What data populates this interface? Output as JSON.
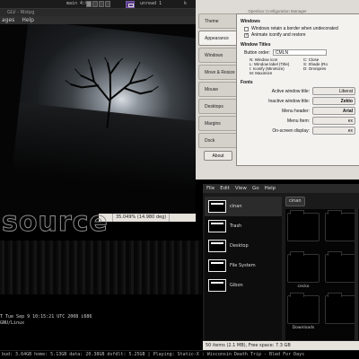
{
  "top_panel": {
    "left_label": "main 4:0",
    "unread_label": "unread 1",
    "right_label": "k"
  },
  "viewer": {
    "title": "GLV - Wstpg",
    "menu": [
      "ages",
      "Help"
    ],
    "status": {
      "zoom": "35.049% (14.980 deg)"
    }
  },
  "wallpaper": {
    "logo_text": "source"
  },
  "terminal": {
    "lines": [
      "T Tue Sep 9 10:15:21 UTC 2008 i686",
      "GNU/Linux"
    ]
  },
  "bottom_bar": {
    "text": "bud: 3.64GB  home: 5.13GB  data: 20.38GB  dsfdlt: 5.25GB | Playing: Static-X : Wisconsin Death Trip - Bled For Days"
  },
  "obconf": {
    "title": "Openbox Configuration Manager",
    "tabs": [
      "Theme",
      "Appearance",
      "Windows",
      "Move & Resize",
      "Mouse",
      "Desktops",
      "Margins",
      "Dock"
    ],
    "active_tab": "Appearance",
    "about_label": "About",
    "windows_heading": "Windows",
    "checks": [
      {
        "label": "Windows retain a border when undecorated",
        "checked": false
      },
      {
        "label": "Animate iconify and restore",
        "checked": true
      }
    ],
    "titles_heading": "Window Titles",
    "button_order_label": "Button order:",
    "button_order_value": "CMLN",
    "legend": [
      "N: Window icon",
      "C: Close",
      "L: Window label (Title)",
      "S: Shade (Ro",
      "I: Iconify (Minimize)",
      "D: Omnipres",
      "M: Maximize",
      ""
    ],
    "fonts_heading": "Fonts",
    "fonts": [
      {
        "label": "Active window title:",
        "value": "Liberat"
      },
      {
        "label": "Inactive window title:",
        "value": "Zekto"
      },
      {
        "label": "Menu header:",
        "value": "Arial"
      },
      {
        "label": "Menu Item:",
        "value": "ex"
      },
      {
        "label": "On-screen display:",
        "value": "ex"
      }
    ]
  },
  "file_manager": {
    "menu": [
      "File",
      "Edit",
      "View",
      "Go",
      "Help"
    ],
    "places": [
      {
        "label": "cinan",
        "active": true
      },
      {
        "label": "Trash",
        "active": false
      },
      {
        "label": "Desktop",
        "active": false
      },
      {
        "label": "File System",
        "active": false
      },
      {
        "label": "Gibon",
        "active": false
      }
    ],
    "path": [
      "cinan"
    ],
    "items": [
      "",
      "",
      "cecko",
      "",
      "Downloads",
      ""
    ],
    "status": "50 items (2.1 MB), Free space: 7.3 GB"
  }
}
